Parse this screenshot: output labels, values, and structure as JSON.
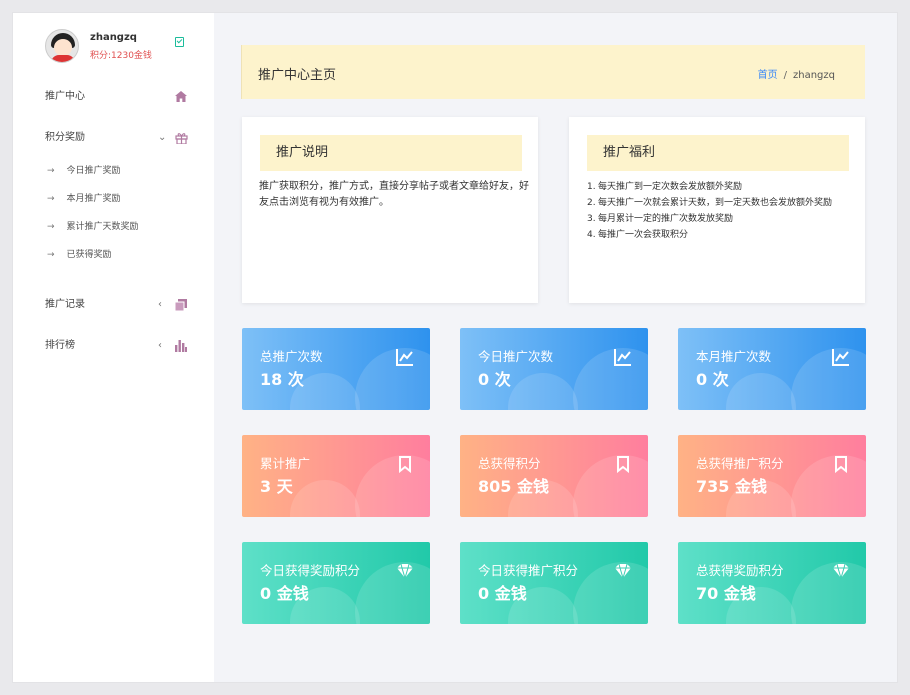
{
  "user": {
    "name": "zhangzq",
    "credits": "积分:1230金钱"
  },
  "sidebar": {
    "items": [
      {
        "label": "推广中心",
        "icon": "home-icon"
      },
      {
        "label": "积分奖励",
        "icon": "gift-icon",
        "chevron": "⌄"
      },
      {
        "label": "推广记录",
        "icon": "copy-icon",
        "chevron": "‹"
      },
      {
        "label": "排行榜",
        "icon": "bar-chart-icon",
        "chevron": "‹"
      }
    ],
    "sub_items": [
      "今日推广奖励",
      "本月推广奖励",
      "累计推广天数奖励",
      "已获得奖励"
    ]
  },
  "header": {
    "title": "推广中心主页",
    "breadcrumb_home": "首页",
    "breadcrumb_sep": "/",
    "breadcrumb_current": "zhangzq"
  },
  "cards": {
    "intro": {
      "title": "推广说明",
      "text": "推广获取积分，推广方式，直接分享帖子或者文章给好友，好友点击浏览有视为有效推广。"
    },
    "benefits": {
      "title": "推广福利",
      "items": [
        {
          "num": "1.",
          "text": "每天推广到一定次数会发放额外奖励"
        },
        {
          "num": "2.",
          "text": "每天推广一次就会累计天数，到一定天数也会发放额外奖励"
        },
        {
          "num": "3.",
          "text": "每月累计一定的推广次数发放奖励"
        },
        {
          "num": "4.",
          "text": "每推广一次会获取积分"
        }
      ]
    }
  },
  "stats": [
    {
      "label": "总推广次数",
      "value": "18 次",
      "color": "blue",
      "icon": "line-chart-icon"
    },
    {
      "label": "今日推广次数",
      "value": "0 次",
      "color": "blue",
      "icon": "line-chart-icon"
    },
    {
      "label": "本月推广次数",
      "value": "0 次",
      "color": "blue",
      "icon": "line-chart-icon"
    },
    {
      "label": "累计推广",
      "value": "3 天",
      "color": "red",
      "icon": "bookmark-icon"
    },
    {
      "label": "总获得积分",
      "value": "805 金钱",
      "color": "red",
      "icon": "bookmark-icon"
    },
    {
      "label": "总获得推广积分",
      "value": "735 金钱",
      "color": "red",
      "icon": "bookmark-icon"
    },
    {
      "label": "今日获得奖励积分",
      "value": "0 金钱",
      "color": "green",
      "icon": "diamond-icon"
    },
    {
      "label": "今日获得推广积分",
      "value": "0 金钱",
      "color": "green",
      "icon": "diamond-icon"
    },
    {
      "label": "总获得奖励积分",
      "value": "70 金钱",
      "color": "green",
      "icon": "diamond-icon"
    }
  ],
  "colors": {
    "accent_blue": "#3d8af7",
    "credit_red": "#e05050",
    "highlight": "#fdf3cc"
  }
}
